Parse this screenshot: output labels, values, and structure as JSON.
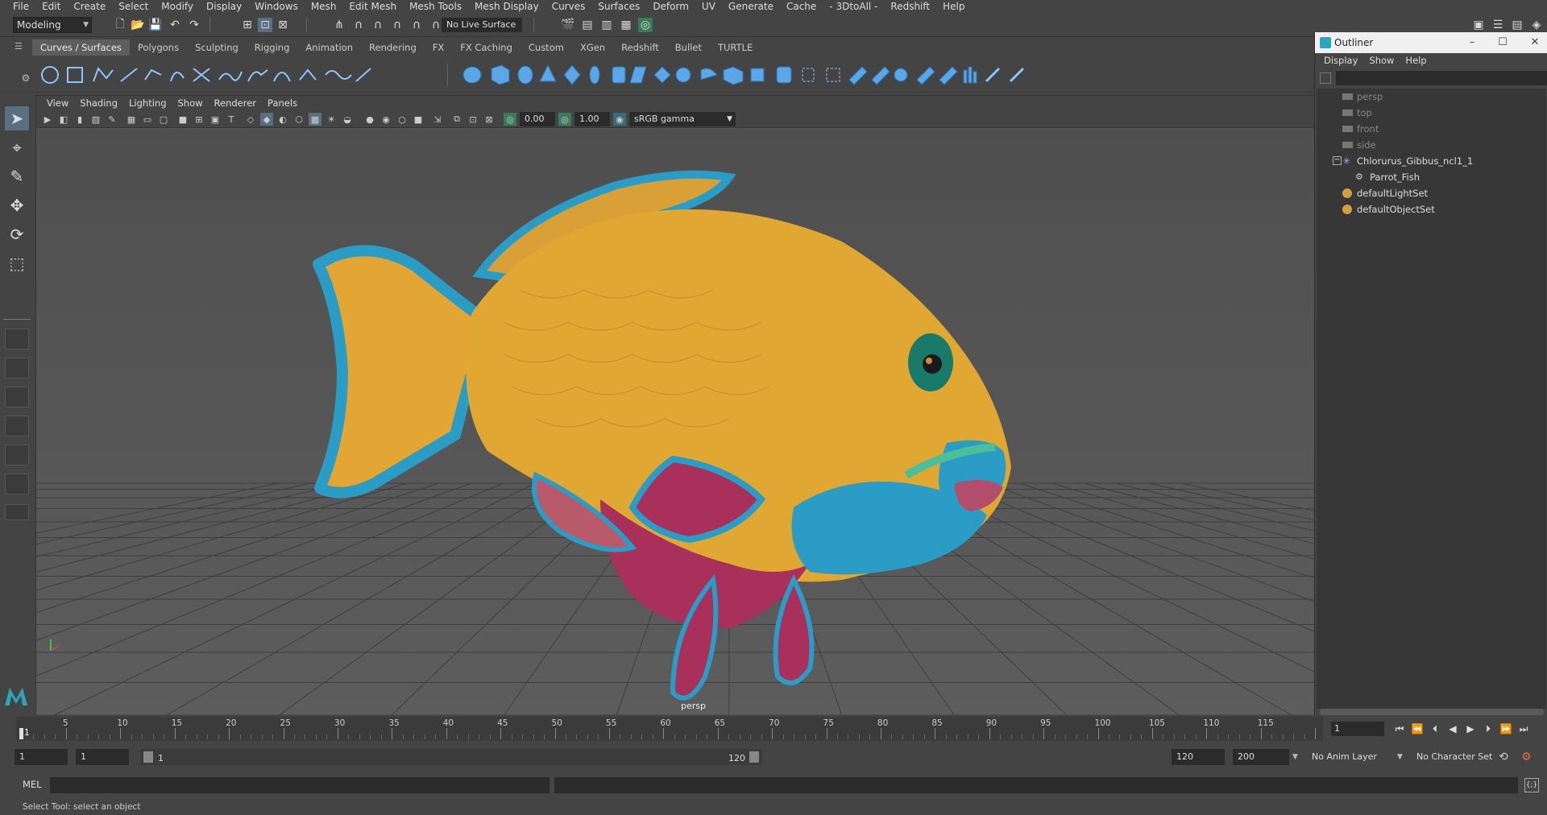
{
  "menu": {
    "items": [
      "File",
      "Edit",
      "Create",
      "Select",
      "Modify",
      "Display",
      "Windows",
      "Mesh",
      "Edit Mesh",
      "Mesh Tools",
      "Mesh Display",
      "Curves",
      "Surfaces",
      "Deform",
      "UV",
      "Generate",
      "Cache",
      "- 3DtoAll -",
      "Redshift",
      "Help"
    ]
  },
  "status": {
    "mode": "Modeling",
    "live_surface": "No Live Surface"
  },
  "shelf": {
    "tabs": [
      "Curves / Surfaces",
      "Polygons",
      "Sculpting",
      "Rigging",
      "Animation",
      "Rendering",
      "FX",
      "FX Caching",
      "Custom",
      "XGen",
      "Redshift",
      "Bullet",
      "TURTLE"
    ],
    "active_tab": "Curves / Surfaces"
  },
  "panel": {
    "menu": [
      "View",
      "Shading",
      "Lighting",
      "Show",
      "Renderer",
      "Panels"
    ],
    "exposure": "0.00",
    "gamma": "1.00",
    "color_space": "sRGB gamma",
    "camera_label": "persp"
  },
  "outliner": {
    "title": "Outliner",
    "menu": [
      "Display",
      "Show",
      "Help"
    ],
    "rows": [
      {
        "label": "persp",
        "kind": "camera"
      },
      {
        "label": "top",
        "kind": "camera"
      },
      {
        "label": "front",
        "kind": "camera"
      },
      {
        "label": "side",
        "kind": "camera"
      },
      {
        "label": "Chlorurus_Gibbus_ncl1_1",
        "kind": "group"
      },
      {
        "label": "Parrot_Fish",
        "kind": "mesh"
      },
      {
        "label": "defaultLightSet",
        "kind": "set"
      },
      {
        "label": "defaultObjectSet",
        "kind": "set"
      }
    ]
  },
  "timeline": {
    "ticks": [
      "5",
      "10",
      "15",
      "20",
      "25",
      "30",
      "35",
      "40",
      "45",
      "50",
      "55",
      "60",
      "65",
      "70",
      "75",
      "80",
      "85",
      "90",
      "95",
      "100",
      "105",
      "110",
      "115"
    ],
    "current_frame": "1",
    "cursor_label": "1"
  },
  "range": {
    "start": "1",
    "playback_start": "1",
    "bar_start": "1",
    "bar_end": "120",
    "playback_end": "120",
    "end": "200",
    "anim_layer": "No Anim Layer",
    "char_set": "No Character Set"
  },
  "cmd": {
    "label": "MEL"
  },
  "help": {
    "text": "Select Tool: select an object"
  },
  "colors": {
    "fish_body": "#e0a832",
    "fish_blue": "#2a9cc6",
    "fish_magenta": "#a8305a",
    "accent_select": "#5a6f82"
  }
}
